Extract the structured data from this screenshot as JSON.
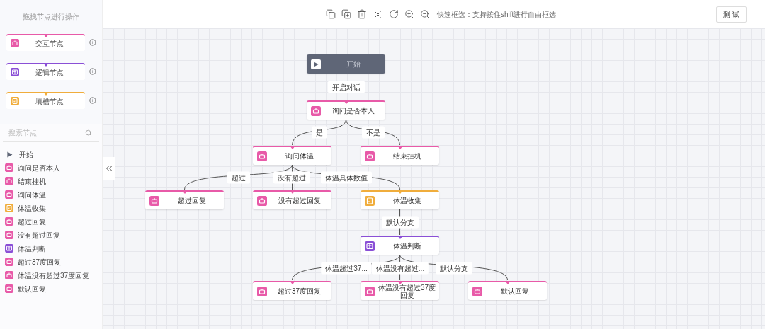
{
  "sidebar": {
    "title": "拖拽节点进行操作",
    "palette": [
      {
        "kind": "interaction",
        "label": "交互节点"
      },
      {
        "kind": "logic",
        "label": "逻辑节点"
      },
      {
        "kind": "slot",
        "label": "填槽节点"
      }
    ],
    "search": {
      "placeholder": "搜索节点"
    },
    "items": [
      {
        "kind": "start",
        "label": "开始"
      },
      {
        "kind": "interaction",
        "label": "询问是否本人"
      },
      {
        "kind": "interaction",
        "label": "结束挂机"
      },
      {
        "kind": "interaction",
        "label": "询问体温"
      },
      {
        "kind": "slot",
        "label": "体温收集"
      },
      {
        "kind": "interaction",
        "label": "超过回复"
      },
      {
        "kind": "interaction",
        "label": "没有超过回复"
      },
      {
        "kind": "logic",
        "label": "体温判断"
      },
      {
        "kind": "interaction",
        "label": "超过37度回复"
      },
      {
        "kind": "interaction",
        "label": "体温没有超过37度回复"
      },
      {
        "kind": "interaction",
        "label": "默认回复"
      }
    ]
  },
  "toolbar": {
    "hint": "快速框选：支持按住shift进行自由框选",
    "test_button": "测 试"
  },
  "canvas": {
    "nodes": [
      {
        "kind": "start",
        "label": "开始"
      },
      {
        "kind": "interaction",
        "label": "询问是否本人"
      },
      {
        "kind": "interaction",
        "label": "询问体温"
      },
      {
        "kind": "interaction",
        "label": "结束挂机"
      },
      {
        "kind": "interaction",
        "label": "超过回复"
      },
      {
        "kind": "interaction",
        "label": "没有超过回复"
      },
      {
        "kind": "slot",
        "label": "体温收集"
      },
      {
        "kind": "logic",
        "label": "体温判断"
      },
      {
        "kind": "interaction",
        "label": "超过37度回复"
      },
      {
        "kind": "interaction",
        "label": "体温没有超过37度回复"
      },
      {
        "kind": "interaction",
        "label": "默认回复"
      }
    ],
    "edges": [
      {
        "label": "开启对话"
      },
      {
        "label": "是"
      },
      {
        "label": "不是"
      },
      {
        "label": "超过"
      },
      {
        "label": "没有超过"
      },
      {
        "label": "体温具体数值"
      },
      {
        "label": "默认分支"
      },
      {
        "label": "体温超过37..."
      },
      {
        "label": "体温没有超过..."
      },
      {
        "label": "默认分支"
      }
    ]
  }
}
